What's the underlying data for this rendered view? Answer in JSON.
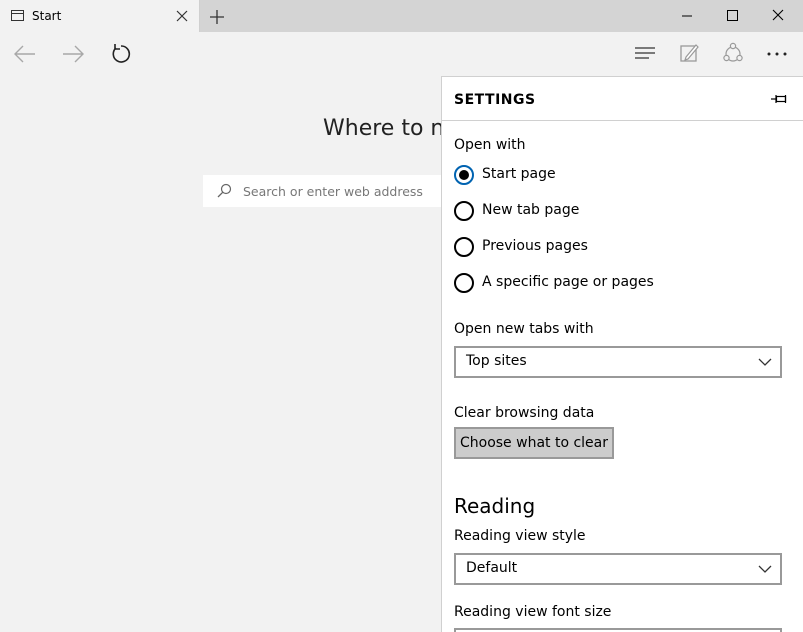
{
  "tab": {
    "title": "Start"
  },
  "start_page": {
    "heading": "Where to n",
    "search_placeholder": "Search or enter web address"
  },
  "settings": {
    "title": "SETTINGS",
    "open_with": {
      "label": "Open with",
      "options": [
        "Start page",
        "New tab page",
        "Previous pages",
        "A specific page or pages"
      ],
      "selected": "Start page"
    },
    "new_tabs": {
      "label": "Open new tabs with",
      "value": "Top sites"
    },
    "clear_data": {
      "label": "Clear browsing data",
      "button": "Choose what to clear"
    },
    "reading": {
      "heading": "Reading",
      "style_label": "Reading view style",
      "style_value": "Default",
      "font_size_label": "Reading view font size"
    }
  },
  "colors": {
    "accent": "#0063b1",
    "panel_bg": "#ffffff",
    "page_bg": "#f2f2f2",
    "titlebar_bg": "#d4d4d4"
  },
  "icons": [
    "page-icon",
    "close-icon",
    "plus-icon",
    "minimize-icon",
    "maximize-icon",
    "back-icon",
    "forward-icon",
    "refresh-icon",
    "hub-icon",
    "note-icon",
    "share-icon",
    "more-icon",
    "search-icon",
    "pin-icon",
    "chevron-down-icon"
  ]
}
